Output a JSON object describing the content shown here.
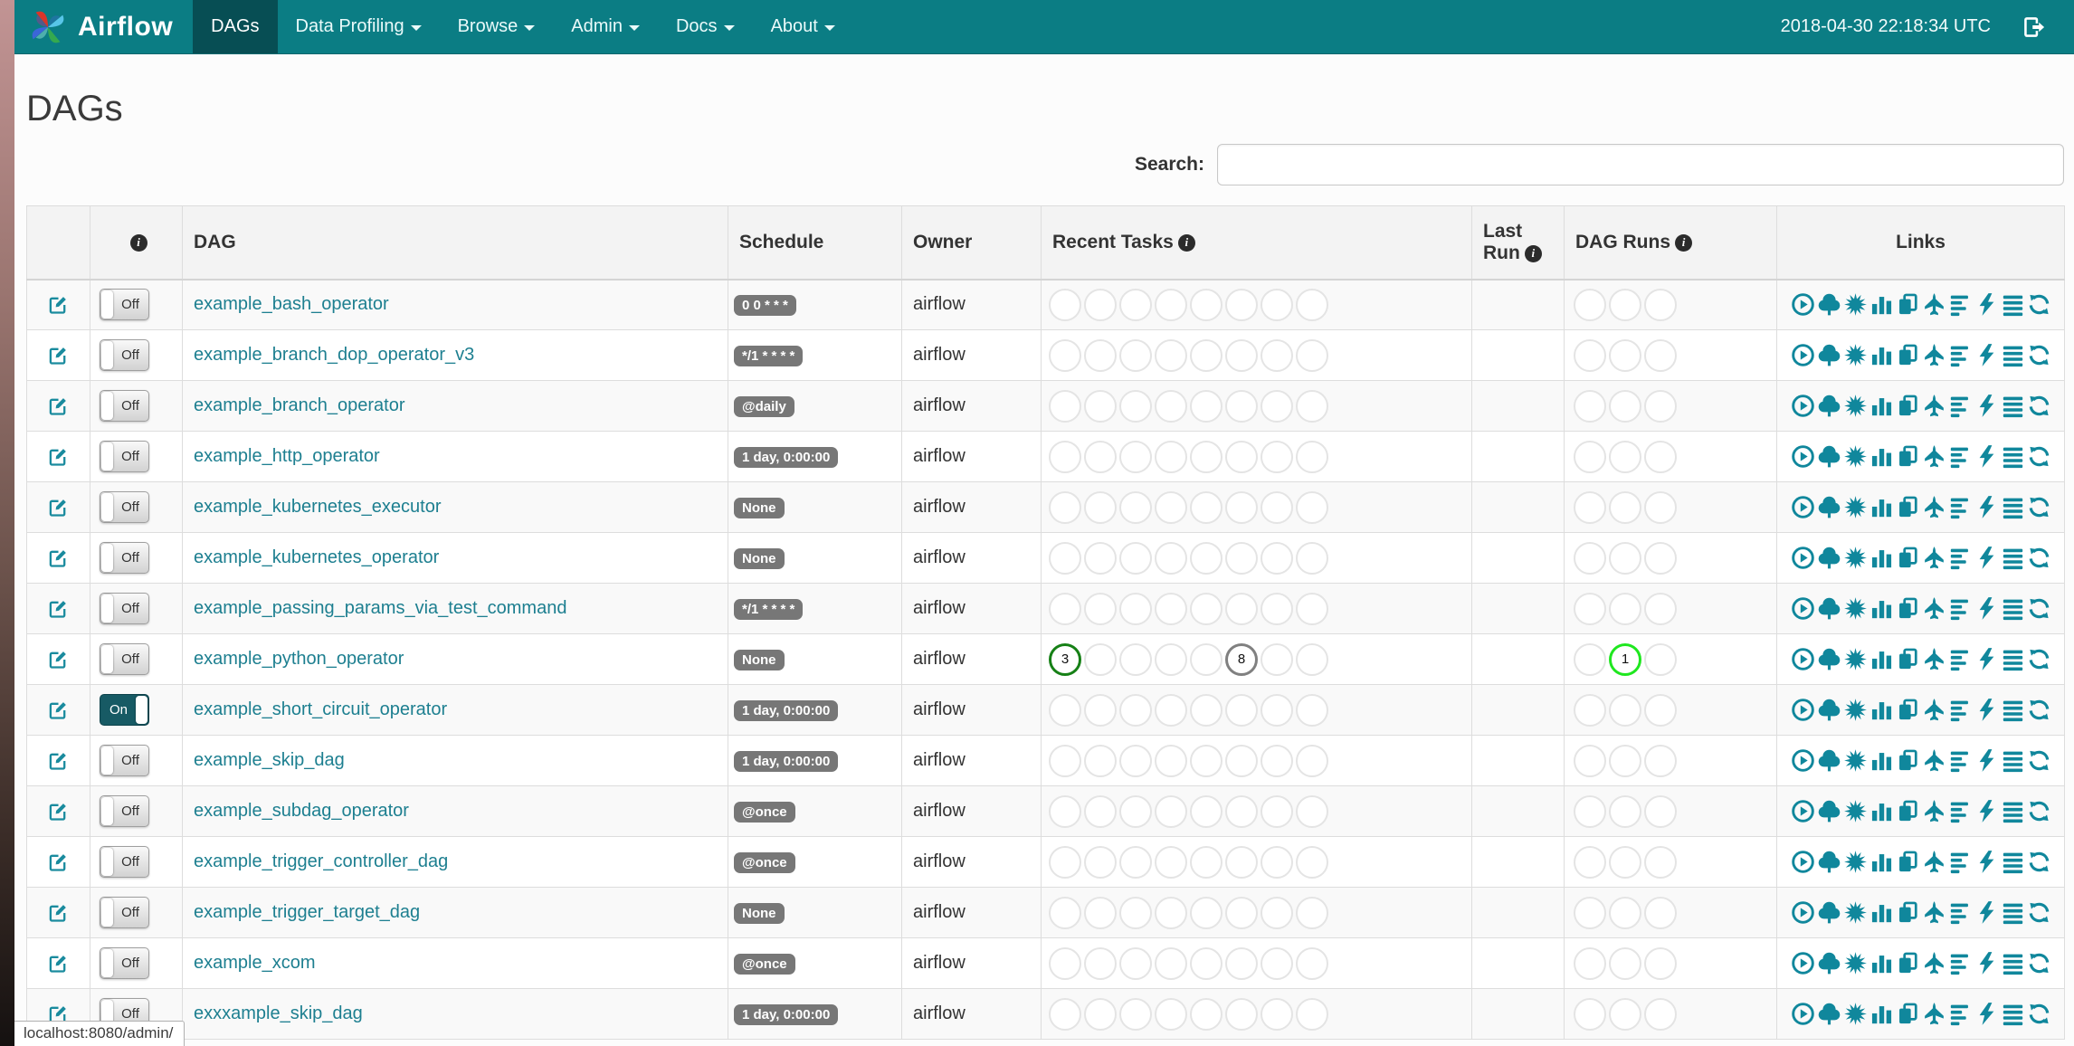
{
  "navbar": {
    "brand": "Airflow",
    "menu": [
      {
        "label": "DAGs",
        "active": true
      },
      {
        "label": "Data Profiling",
        "active": false
      },
      {
        "label": "Browse",
        "active": false
      },
      {
        "label": "Admin",
        "active": false
      },
      {
        "label": "Docs",
        "active": false
      },
      {
        "label": "About",
        "active": false
      }
    ],
    "clock": "2018-04-30 22:18:34 UTC"
  },
  "page": {
    "title": "DAGs",
    "search_label": "Search:",
    "search_value": "",
    "status_bar": "localhost:8080/admin/"
  },
  "table": {
    "headers": {
      "dag": "DAG",
      "schedule": "Schedule",
      "owner": "Owner",
      "recent_tasks": "Recent Tasks",
      "last_run": "Last Run",
      "dag_runs": "DAG Runs",
      "links": "Links",
      "info_glyph": "i"
    },
    "recent_task_slots": 8,
    "dag_run_slots": 3,
    "link_icons": [
      "trigger-dag-icon",
      "tree-view-icon",
      "graph-view-icon",
      "task-duration-icon",
      "task-tries-icon",
      "landing-times-icon",
      "gantt-icon",
      "code-view-icon",
      "logs-icon",
      "refresh-icon"
    ],
    "toggle_on_label": "On",
    "toggle_off_label": "Off",
    "rows": [
      {
        "name": "example_bash_operator",
        "toggle": "Off",
        "schedule": "0 0 * * *",
        "owner": "airflow",
        "recent_tasks": [],
        "dag_runs": []
      },
      {
        "name": "example_branch_dop_operator_v3",
        "toggle": "Off",
        "schedule": "*/1 * * * *",
        "owner": "airflow",
        "recent_tasks": [],
        "dag_runs": []
      },
      {
        "name": "example_branch_operator",
        "toggle": "Off",
        "schedule": "@daily",
        "owner": "airflow",
        "recent_tasks": [],
        "dag_runs": []
      },
      {
        "name": "example_http_operator",
        "toggle": "Off",
        "schedule": "1 day, 0:00:00",
        "owner": "airflow",
        "recent_tasks": [],
        "dag_runs": []
      },
      {
        "name": "example_kubernetes_executor",
        "toggle": "Off",
        "schedule": "None",
        "owner": "airflow",
        "recent_tasks": [],
        "dag_runs": []
      },
      {
        "name": "example_kubernetes_operator",
        "toggle": "Off",
        "schedule": "None",
        "owner": "airflow",
        "recent_tasks": [],
        "dag_runs": []
      },
      {
        "name": "example_passing_params_via_test_command",
        "toggle": "Off",
        "schedule": "*/1 * * * *",
        "owner": "airflow",
        "recent_tasks": [],
        "dag_runs": []
      },
      {
        "name": "example_python_operator",
        "toggle": "Off",
        "schedule": "None",
        "owner": "airflow",
        "recent_tasks": [
          {
            "slot": 0,
            "count": "3",
            "state": "success"
          },
          {
            "slot": 5,
            "count": "8",
            "state": "none"
          }
        ],
        "dag_runs": [
          {
            "slot": 1,
            "count": "1",
            "state": "running"
          }
        ]
      },
      {
        "name": "example_short_circuit_operator",
        "toggle": "On",
        "schedule": "1 day, 0:00:00",
        "owner": "airflow",
        "recent_tasks": [],
        "dag_runs": []
      },
      {
        "name": "example_skip_dag",
        "toggle": "Off",
        "schedule": "1 day, 0:00:00",
        "owner": "airflow",
        "recent_tasks": [],
        "dag_runs": []
      },
      {
        "name": "example_subdag_operator",
        "toggle": "Off",
        "schedule": "@once",
        "owner": "airflow",
        "recent_tasks": [],
        "dag_runs": []
      },
      {
        "name": "example_trigger_controller_dag",
        "toggle": "Off",
        "schedule": "@once",
        "owner": "airflow",
        "recent_tasks": [],
        "dag_runs": []
      },
      {
        "name": "example_trigger_target_dag",
        "toggle": "Off",
        "schedule": "None",
        "owner": "airflow",
        "recent_tasks": [],
        "dag_runs": []
      },
      {
        "name": "example_xcom",
        "toggle": "Off",
        "schedule": "@once",
        "owner": "airflow",
        "recent_tasks": [],
        "dag_runs": []
      },
      {
        "name": "exxxample_skip_dag",
        "toggle": "Off",
        "schedule": "1 day, 0:00:00",
        "owner": "airflow",
        "recent_tasks": [],
        "dag_runs": []
      }
    ]
  },
  "colors": {
    "navbar": "#0b7d84",
    "navbar_active": "#074e54",
    "link": "#1d7f90",
    "icon": "#10879c",
    "badge": "#777777",
    "toggle_on": "#175a64",
    "state_success": "#168016",
    "state_none": "#808080",
    "state_running": "#1fe71f",
    "empty_circle": "#e4e4e4"
  }
}
